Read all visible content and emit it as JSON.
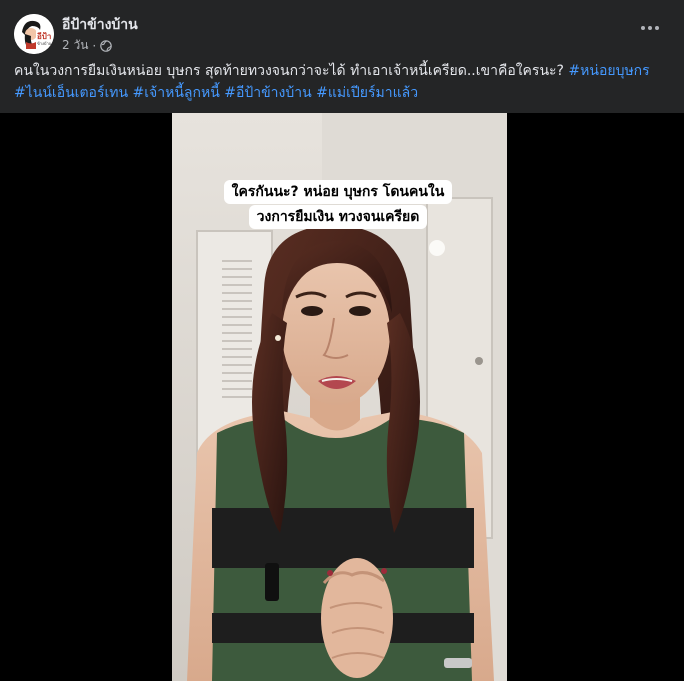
{
  "post": {
    "page_name": "อีป้าข้างบ้าน",
    "time_ago": "2 วัน",
    "dot": "·",
    "caption_text": "คนในวงการยืมเงินหน่อย บุษกร สุดท้ายทวงจนกว่าจะได้ ทำเอาเจ้าหนี้เครียด..เขาคือใครนะ?",
    "hashtags": [
      "#หน่อยบุษกร",
      "#ไนน์เอ็นเตอร์เทน",
      "#เจ้าหนี้ลูกหนี้",
      "#อีป้าข้างบ้าน",
      "#แม่เปียร์มาแล้ว"
    ]
  },
  "video": {
    "subtitle_lines": [
      "ใครกันนะ? หน่อย บุษกร โดนคนใน",
      "วงการยืมเงิน ทวงจนเครียด"
    ]
  },
  "icons": {
    "globe": "globe-icon",
    "more": "more-options-icon"
  },
  "colors": {
    "header_bg": "#242526",
    "text_primary": "#e4e6eb",
    "text_secondary": "#b0b3b8",
    "hashtag": "#4599ff",
    "stage_bg": "#000000"
  }
}
